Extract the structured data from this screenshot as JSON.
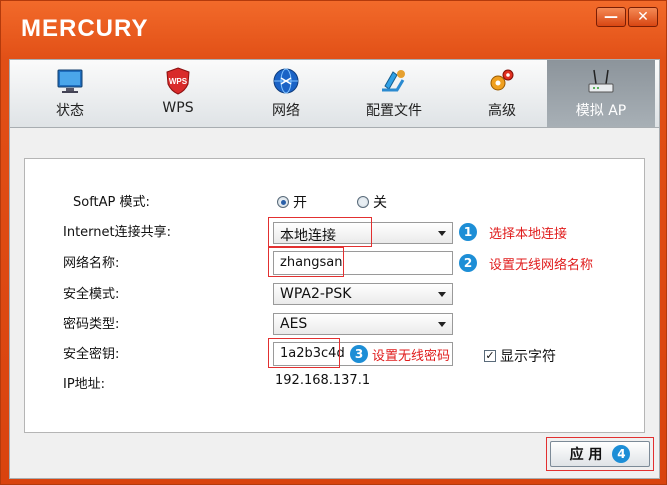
{
  "app": {
    "brand": "MERCURY"
  },
  "window_controls": {
    "minimize": "—",
    "close": "✕"
  },
  "tabs": [
    {
      "label": "状态",
      "icon": "monitor-icon"
    },
    {
      "label": "WPS",
      "icon": "wps-shield-icon"
    },
    {
      "label": "网络",
      "icon": "network-globe-icon"
    },
    {
      "label": "配置文件",
      "icon": "profile-config-icon"
    },
    {
      "label": "高级",
      "icon": "gears-icon"
    },
    {
      "label": "模拟 AP",
      "icon": "router-icon",
      "active": true
    }
  ],
  "form": {
    "softap_label": "SoftAP 模式:",
    "softap_on": "开",
    "softap_off": "关",
    "softap_selected": "开",
    "internet_label": "Internet连接共享:",
    "internet_value": "本地连接",
    "ssid_label": "网络名称:",
    "ssid_value": "zhangsan",
    "security_label": "安全模式:",
    "security_value": "WPA2-PSK",
    "cipher_label": "密码类型:",
    "cipher_value": "AES",
    "key_label": "安全密钥:",
    "key_value": "1a2b3c4d",
    "show_chars_label": "显示字符",
    "show_chars_checked": true,
    "ip_label": "IP地址:",
    "ip_value": "192.168.137.1"
  },
  "annotations": [
    {
      "number": "1",
      "text": "选择本地连接"
    },
    {
      "number": "2",
      "text": "设置无线网络名称"
    },
    {
      "number": "3",
      "text": "设置无线密码"
    },
    {
      "number": "4"
    }
  ],
  "apply_label": "应 用",
  "colors": {
    "accent": "#e9531c",
    "annotation_red": "#e01c1c",
    "badge_blue": "#1d8ed6"
  }
}
